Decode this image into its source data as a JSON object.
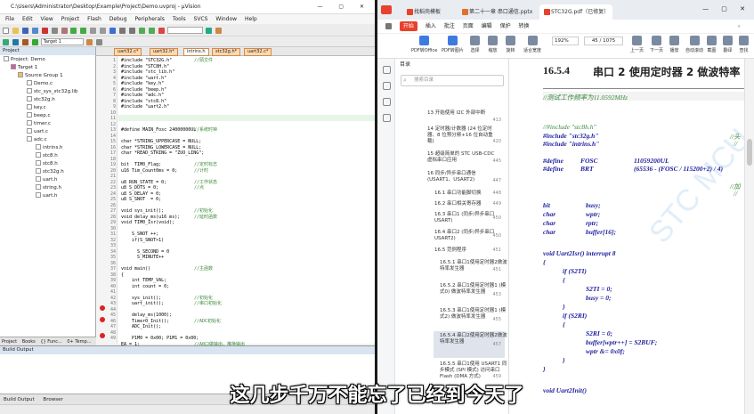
{
  "keil": {
    "title": "C:\\Users\\Administrator\\Desktop\\Example\\Project\\Demo.uvproj - µVision",
    "menu": [
      "File",
      "Edit",
      "View",
      "Project",
      "Flash",
      "Debug",
      "Peripherals",
      "Tools",
      "SVCS",
      "Window",
      "Help"
    ],
    "target": "Target 1",
    "project_header": "Project",
    "tree": [
      "Project: Demo",
      "Target 1",
      "Source Group 1",
      "Demo.c",
      "stc_sys_stc32g.lib",
      "stc32g.h",
      "key.c",
      "beep.c",
      "timer.c",
      "uart.c",
      "adc.c",
      "intrins.h",
      "stc8.h",
      "stc8.h",
      "stc32g.h",
      "uart.h",
      "string.h",
      "uart.h"
    ],
    "project_tabs": [
      "Project",
      "Books",
      "{} Func...",
      "0+ Temp..."
    ],
    "file_tabs": [
      "uart32.c*",
      "uart32.h*",
      "intrins.h",
      "stc32g.h*",
      "uart32.c*"
    ],
    "line_numbers": [
      "1",
      "2",
      "3",
      "4",
      "5",
      "6",
      "7",
      "8",
      "9",
      "10",
      "11",
      "12",
      "13",
      "14",
      "15",
      "16",
      "17",
      "18",
      "19",
      "20",
      "21",
      "22",
      "23",
      "24",
      "25",
      "26",
      "27",
      "28",
      "29",
      "30",
      "31",
      "32",
      "33",
      "34",
      "35",
      "36",
      "37",
      "38",
      "39",
      "40",
      "41",
      "42",
      "43",
      "44",
      "45",
      "46",
      "47",
      "48",
      "49"
    ],
    "code": [
      "#include \"STC32G.h\"",
      "#include \"STC8H.h\"",
      "#include \"stc_lib.h\"",
      "#include \"uart.h\"",
      "#include \"key.h\"",
      "#include \"beep.h\"",
      "#include \"adc.h\"",
      "#include \"stc8.h\"",
      "#include \"uart2.h\"",
      "",
      "",
      "",
      "#define MAIN_Fosc 24000000UL",
      "",
      "char *STRING_UPPERCASE = NULL;",
      "char *STRING_LOWERCASE = NULL;",
      "char *READ_STRING = \"ZUO_LING\";",
      "",
      "bit  TIM0_Flag;",
      "u16 Tim_Count0ms = 0;",
      "",
      "u8 RUN_STATE = 0;",
      "u8 S_DOTS = 0;",
      "u8 S_DELAY = 0;",
      "u8 S_SNOT  = 0;",
      "",
      "void sys_init();",
      "void delay_ms(u16 ms);",
      "void TIM0_Isr(void);",
      "",
      "    S_SNOT ++;",
      "    if(S_SNOT>1)",
      "",
      "      S_SECOND = 0",
      "      S_MINUTE++",
      "",
      "void main()",
      "{",
      "    int TEMP_VAL;",
      "    int count = 0;",
      "",
      "    sys_init();",
      "    uart_init();",
      "",
      "    delay_ms(1000);",
      "    Timer0_Init();",
      "    ADC_Init();",
      "",
      "    P1M0 = 0x00; P1M1 = 0x00;"
    ],
    "comments": [
      "//頭文件",
      "",
      "",
      "",
      "",
      "",
      "",
      "",
      "",
      "",
      "",
      "",
      "//系统时钟",
      "",
      "",
      "",
      "",
      "",
      "//定时标志",
      "//计时",
      "",
      "//工作状态",
      "//点",
      "",
      "",
      "",
      "//初始化",
      "//延时函数",
      "",
      "",
      "",
      "",
      "",
      "",
      "",
      "",
      "//主函数",
      "",
      "",
      "",
      "",
      "//初始化",
      "//串口初始化",
      "",
      "",
      "//ADC初始化",
      "",
      "",
      "",
      ""
    ],
    "comment_tail": "//A0口做输出，推挽输出",
    "line50": "EA = 1;",
    "build_header": "Build Output",
    "build_tabs": [
      "Build Output",
      "Browser"
    ]
  },
  "wps": {
    "tabs": [
      "找稻壳模板",
      "第二十一章 串口通信.pptx",
      "STC32G.pdf（已修复）"
    ],
    "menu": [
      "开始",
      "插入",
      "批注",
      "页面",
      "编辑",
      "保护",
      "转换"
    ],
    "ribbon": [
      "PDF转Office",
      "PDF转图片",
      "选择",
      "缩放",
      "旋转",
      "适合宽度",
      "192%",
      "45 / 1075",
      "上一页",
      "下一页",
      "播放",
      "自动滚动",
      "截图",
      "翻译",
      "查找"
    ],
    "zoom": "192%",
    "page": "45 / 1075",
    "toc_header": "目录",
    "search_placeholder": "搜索目录",
    "toc": [
      {
        "t": "13 开始使用 I2C 外部中断",
        "p": "413"
      },
      {
        "t": "14 定时器/计数器 (24 位定时器、8 位预分频+16 位自动重载)",
        "p": "420"
      },
      {
        "t": "15 超级简单的 STC USB-CDC 虚拟串口应用",
        "p": "445"
      },
      {
        "t": "16 同步/异步串口通信 (USART1、USART2)",
        "p": "447"
      },
      {
        "t": "16.1 串口功能脚切换",
        "p": "448"
      },
      {
        "t": "16.2 串口相关寄存器",
        "p": "449"
      },
      {
        "t": "16.3 串口1 (同步/异步串口 USART)",
        "p": "450"
      },
      {
        "t": "16.4 串口2 (同步/异步串口 USART2)",
        "p": "450"
      },
      {
        "t": "16.5 范例程序",
        "p": "451"
      },
      {
        "t": "16.5.1 串口1使用定时器2做波特率发生器",
        "p": "451"
      },
      {
        "t": "16.5.2 串口1使用定时器1 (模式0) 做波特率发生器",
        "p": "453"
      },
      {
        "t": "16.5.3 串口1使用定时器1 (模式2) 做波特率发生器",
        "p": "455"
      },
      {
        "t": "16.5.4 串口2使用定时器2做波特率发生器",
        "p": "457"
      },
      {
        "t": "16.5.5 串口1使用 USART1 同步模式 (SPI 模式) 访问串口 Flash (DMA 方式)",
        "p": "459"
      }
    ],
    "doc": {
      "heading_num": "16.5.4",
      "heading": "串口 2 使用定时器 2 做波特率",
      "comment1": "//测试工作频率为11.0592MHz",
      "include1": "//#include \"stc8h.h\"",
      "include2": "#include \"stc32g.h\"",
      "include3": "#include \"intrins.h\"",
      "c_tail1": "//头",
      "c_tail2": "//",
      "def1": "#define",
      "def1n": "FOSC",
      "def1v": "11059200UL",
      "def2": "#define",
      "def2n": "BRT",
      "def2v": "(65536 - (FOSC / 115200+2) / 4)",
      "c_tail3": "//加",
      "c_tail4": "//",
      "v1t": "bit",
      "v1n": "busy;",
      "v2t": "char",
      "v2n": "wptr;",
      "v3t": "char",
      "v3n": "rptr;",
      "v4t": "char",
      "v4n": "buffer[16];",
      "isr": "void Uart2Isr() interrupt 8",
      "b1": "{",
      "if1": "if (S2TI)",
      "b2": "{",
      "s1": "S2TI = 0;",
      "s2": "busy = 0;",
      "b3": "}",
      "if2": "if (S2RI)",
      "b4": "{",
      "s3": "S2RI = 0;",
      "s4": "buffer[wptr++] = S2BUF;",
      "s5": "wptr &= 0x0f;",
      "b5": "}",
      "b6": "}",
      "last": "void Uart2Init()",
      "watermark": "STC MCU"
    }
  },
  "subtitle": "这几步千万不能忘了已经到今天了"
}
